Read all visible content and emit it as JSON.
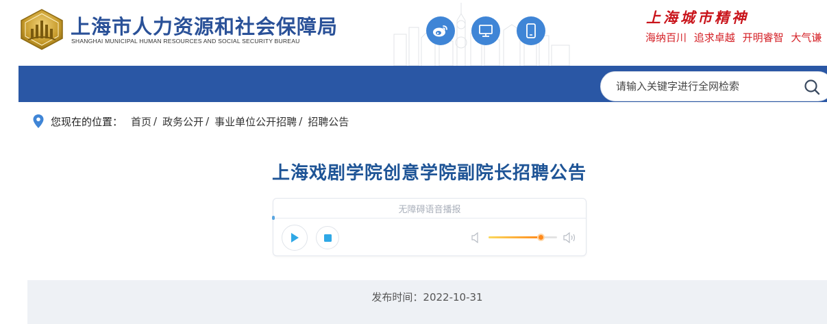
{
  "header": {
    "org_name_cn": "上海市人力资源和社会保障局",
    "org_name_en": "SHANGHAI MUNICIPAL HUMAN RESOURCES AND SOCIAL SECURITY BUREAU",
    "icons": [
      "weibo-icon",
      "desktop-icon",
      "mobile-icon"
    ],
    "accent_color": "#3f85d6"
  },
  "city_spirit": {
    "title": "上海城市精神",
    "items": [
      "海纳百川",
      "追求卓越",
      "开明睿智",
      "大气谦"
    ]
  },
  "navbar": {
    "color": "#2a57a5",
    "search": {
      "placeholder": "请输入关键字进行全网检索"
    }
  },
  "breadcrumb": {
    "label": "您现在的位置：",
    "items": [
      "首页",
      "政务公开",
      "事业单位公开招聘",
      "招聘公告"
    ],
    "separator": "/"
  },
  "article": {
    "title": "上海戏剧学院创意学院副院长招聘公告",
    "publish_label": "发布时间：",
    "publish_date": "2022-10-31"
  },
  "player": {
    "label": "无障碍语音播报",
    "volume": 0.76
  }
}
